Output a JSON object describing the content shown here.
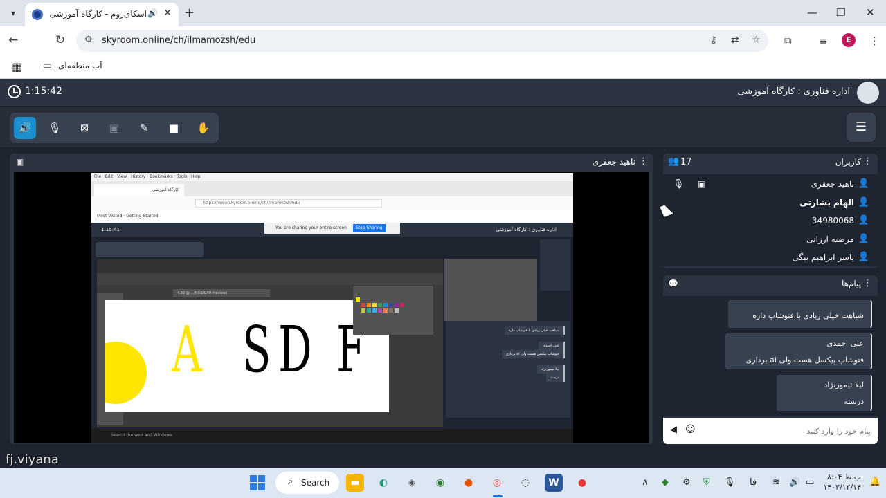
{
  "browser": {
    "tab_title": "اسکای‌روم - کارگاه آموزشی",
    "url": "skyroom.online/ch/ilmamozsh/edu",
    "bookmark_folder": "آب منطقه‌ای",
    "profile_initial": "E"
  },
  "app": {
    "timer": "1:15:42",
    "room_title": "اداره فناوری : کارگاه آموزشی"
  },
  "video": {
    "presenter": "ناهید جعفری"
  },
  "shared_screen": {
    "timer": "1:15:41",
    "room_title": "اداره فناوری : کارگاه آموزشی",
    "url": "https://www.skyroom.online/ch/ilmamozsh/edu",
    "sharing_notice": "You are sharing your entire screen",
    "stop_sharing": "Stop Sharing",
    "doc_tab": "4.32 @ ...(RGB/GPU Preview)",
    "letters": [
      "A",
      "S",
      "D",
      "F"
    ],
    "taskbar_search": "Search the web and Windows",
    "bubbles": [
      "شباهت خیلی زیادی با فتوشاپ داره",
      "علی احمدی",
      "فتوشاپ پیکسل هست ولی ai برداری",
      "لیلا تیمورنژاد",
      "درسته"
    ]
  },
  "users": {
    "title": "کاربران",
    "count": "17",
    "list": [
      {
        "name": "ناهید جعفری",
        "bold": false,
        "color": "#3ea6ff"
      },
      {
        "name": "الهام بشارتی",
        "bold": true,
        "color": "#3ea6ff"
      },
      {
        "name": "34980068",
        "bold": false,
        "color": "#f5c518"
      },
      {
        "name": "مرضیه ارزانی",
        "bold": false,
        "color": "#f5c518"
      },
      {
        "name": "یاسر ابراهیم بیگی",
        "bold": false,
        "color": "#f5c518"
      }
    ]
  },
  "chat": {
    "title": "پیام‌ها",
    "messages": [
      {
        "sender": "",
        "text": "شباهت خیلی زیادی با فتوشاپ داره"
      },
      {
        "sender": "علی احمدی",
        "text": "فتوشاپ پیکسل هست ولی ai برداری"
      },
      {
        "sender": "لیلا تیمورنژاد",
        "text": "درسته"
      }
    ],
    "input_placeholder": "پیام خود را وارد کنید"
  },
  "watermark": "fj.viyana",
  "taskbar": {
    "search_label": "Search",
    "lang": "فا",
    "time": "۸:۰۴ ب.ظ",
    "date": "۱۴۰۳/۱۲/۱۴"
  },
  "colors": {
    "accent": "#1b8fd0",
    "panel": "#2b3340",
    "background": "#1e2530"
  }
}
